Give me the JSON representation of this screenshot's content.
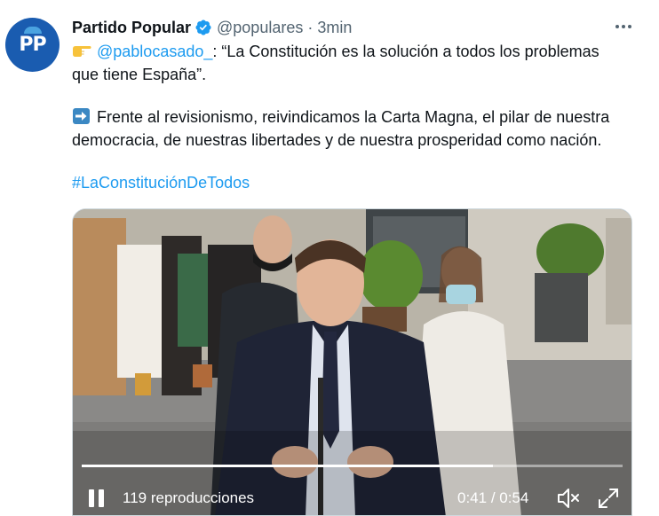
{
  "tweet": {
    "author_name": "Partido Popular",
    "handle": "@populares",
    "separator": "·",
    "time": "3min",
    "avatar_text": "PP",
    "paragraph1": {
      "mention": "@pablocasado_",
      "text_line1": ": “La Constitución es la solución a todos los problemas",
      "text_line2": "que tiene España”."
    },
    "paragraph2": {
      "text_line1": "Frente al revisionismo, reivindicamos la Carta Magna, el pilar de nuestra",
      "text_line2": "democracia, de nuestras libertades y de nuestra prosperidad como nación."
    },
    "hashtag": "#LaConstituciónDeTodos"
  },
  "video": {
    "views": "119 reproducciones",
    "elapsed": "0:41",
    "time_separator": " / ",
    "duration": "0:54",
    "progress": 0.76
  },
  "icons": {
    "verified": "verified-badge-icon",
    "more": "more-options-icon",
    "pointing": "backhand-index-pointing-right-emoji",
    "arrow": "right-arrow-emoji",
    "pause": "pause-icon",
    "mute": "muted-speaker-icon",
    "fullscreen": "fullscreen-icon"
  },
  "colors": {
    "link": "#1d9bf0",
    "avatar_bg": "#1a5cb0",
    "text": "#0f1419",
    "secondary": "#536471"
  }
}
